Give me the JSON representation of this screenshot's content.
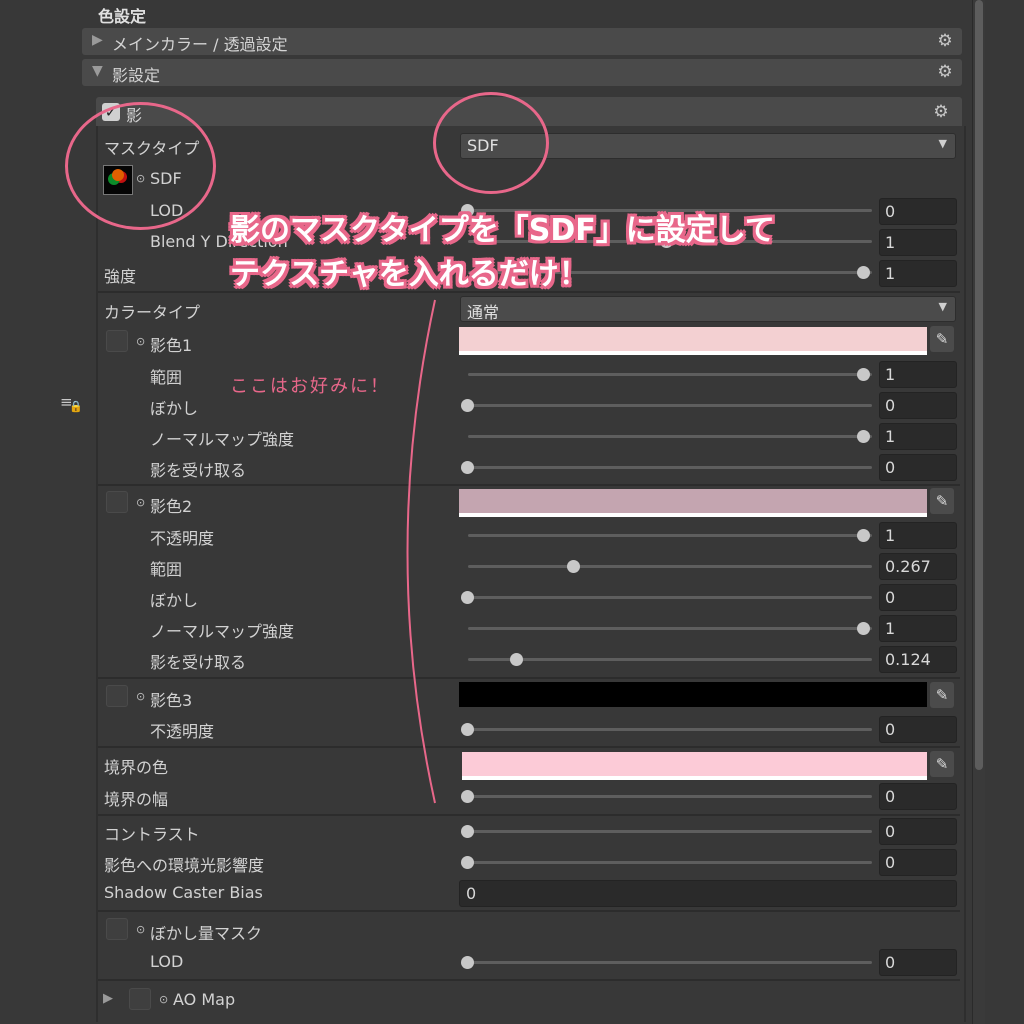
{
  "header": {
    "section_title": "色設定"
  },
  "foldouts": [
    {
      "label": "メインカラー / 透過設定",
      "expanded": false
    },
    {
      "label": "影設定",
      "expanded": true
    }
  ],
  "shadow": {
    "enable_label": "影",
    "enabled": true,
    "mask_type_label": "マスクタイプ",
    "mask_type_value": "SDF",
    "texture_label": "SDF",
    "lod_label": "LOD",
    "lod_value": "0",
    "blendy_label": "Blend Y Direction",
    "blendy_value": "1",
    "strength_label": "強度",
    "strength_value": "1",
    "color_type_label": "カラータイプ",
    "color_type_value": "通常",
    "color1": {
      "label": "影色1",
      "color": "#f3d0d2",
      "range_label": "範囲",
      "range_value": "1",
      "range_frac": 1,
      "blur_label": "ぼかし",
      "blur_value": "0",
      "blur_frac": 0,
      "normal_label": "ノーマルマップ強度",
      "normal_value": "1",
      "normal_frac": 1,
      "receive_label": "影を受け取る",
      "receive_value": "0",
      "receive_frac": 0
    },
    "color2": {
      "label": "影色2",
      "color": "#c4a5b0",
      "opacity_label": "不透明度",
      "opacity_value": "1",
      "opacity_frac": 1,
      "range_label": "範囲",
      "range_value": "0.267",
      "range_frac": 0.267,
      "blur_label": "ぼかし",
      "blur_value": "0",
      "blur_frac": 0,
      "normal_label": "ノーマルマップ強度",
      "normal_value": "1",
      "normal_frac": 1,
      "receive_label": "影を受け取る",
      "receive_value": "0.124",
      "receive_frac": 0.124
    },
    "color3": {
      "label": "影色3",
      "color": "#000000",
      "opacity_label": "不透明度",
      "opacity_value": "0",
      "opacity_frac": 0
    },
    "border_color_label": "境界の色",
    "border_color": "#fccbd7",
    "border_width_label": "境界の幅",
    "border_width_value": "0",
    "contrast_label": "コントラスト",
    "contrast_value": "0",
    "env_light_label": "影色への環境光影響度",
    "env_light_value": "0",
    "caster_bias_label": "Shadow Caster Bias",
    "caster_bias_value": "0",
    "blur_mask_label": "ぼかし量マスク",
    "blur_mask_lod_label": "LOD",
    "blur_mask_lod_value": "0",
    "ao_map_label": "AO Map"
  },
  "annotation": {
    "main_line1": "影のマスクタイプを「SDF」に設定して",
    "main_line2": "テクスチャを入れるだけ！",
    "note": "ここはお好みに！",
    "accent_color": "#e8678a"
  },
  "icons": [
    "gear-icon",
    "checkmark-icon",
    "eyedropper-icon",
    "dropdown-caret-icon",
    "foldout-arrow-icon",
    "lock-icon"
  ]
}
